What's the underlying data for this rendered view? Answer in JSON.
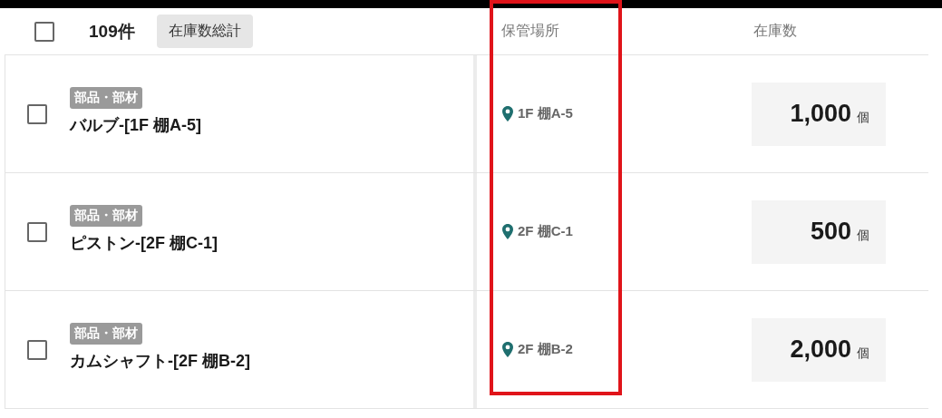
{
  "header": {
    "select_all": {
      "checked": false
    },
    "count": "109件",
    "total_button": "在庫数総計",
    "columns": [
      "保管場所",
      "在庫数"
    ]
  },
  "rows": [
    {
      "checked": false,
      "tag": "部品・部材",
      "name": "バルブ-[1F 棚A-5]",
      "location": "1F 棚A-5",
      "quantity": "1,000",
      "unit": "個"
    },
    {
      "checked": false,
      "tag": "部品・部材",
      "name": "ピストン-[2F 棚C-1]",
      "location": "2F 棚C-1",
      "quantity": "500",
      "unit": "個"
    },
    {
      "checked": false,
      "tag": "部品・部材",
      "name": "カムシャフト-[2F 棚B-2]",
      "location": "2F 棚B-2",
      "quantity": "2,000",
      "unit": "個"
    }
  ],
  "highlight": {
    "on": true
  }
}
